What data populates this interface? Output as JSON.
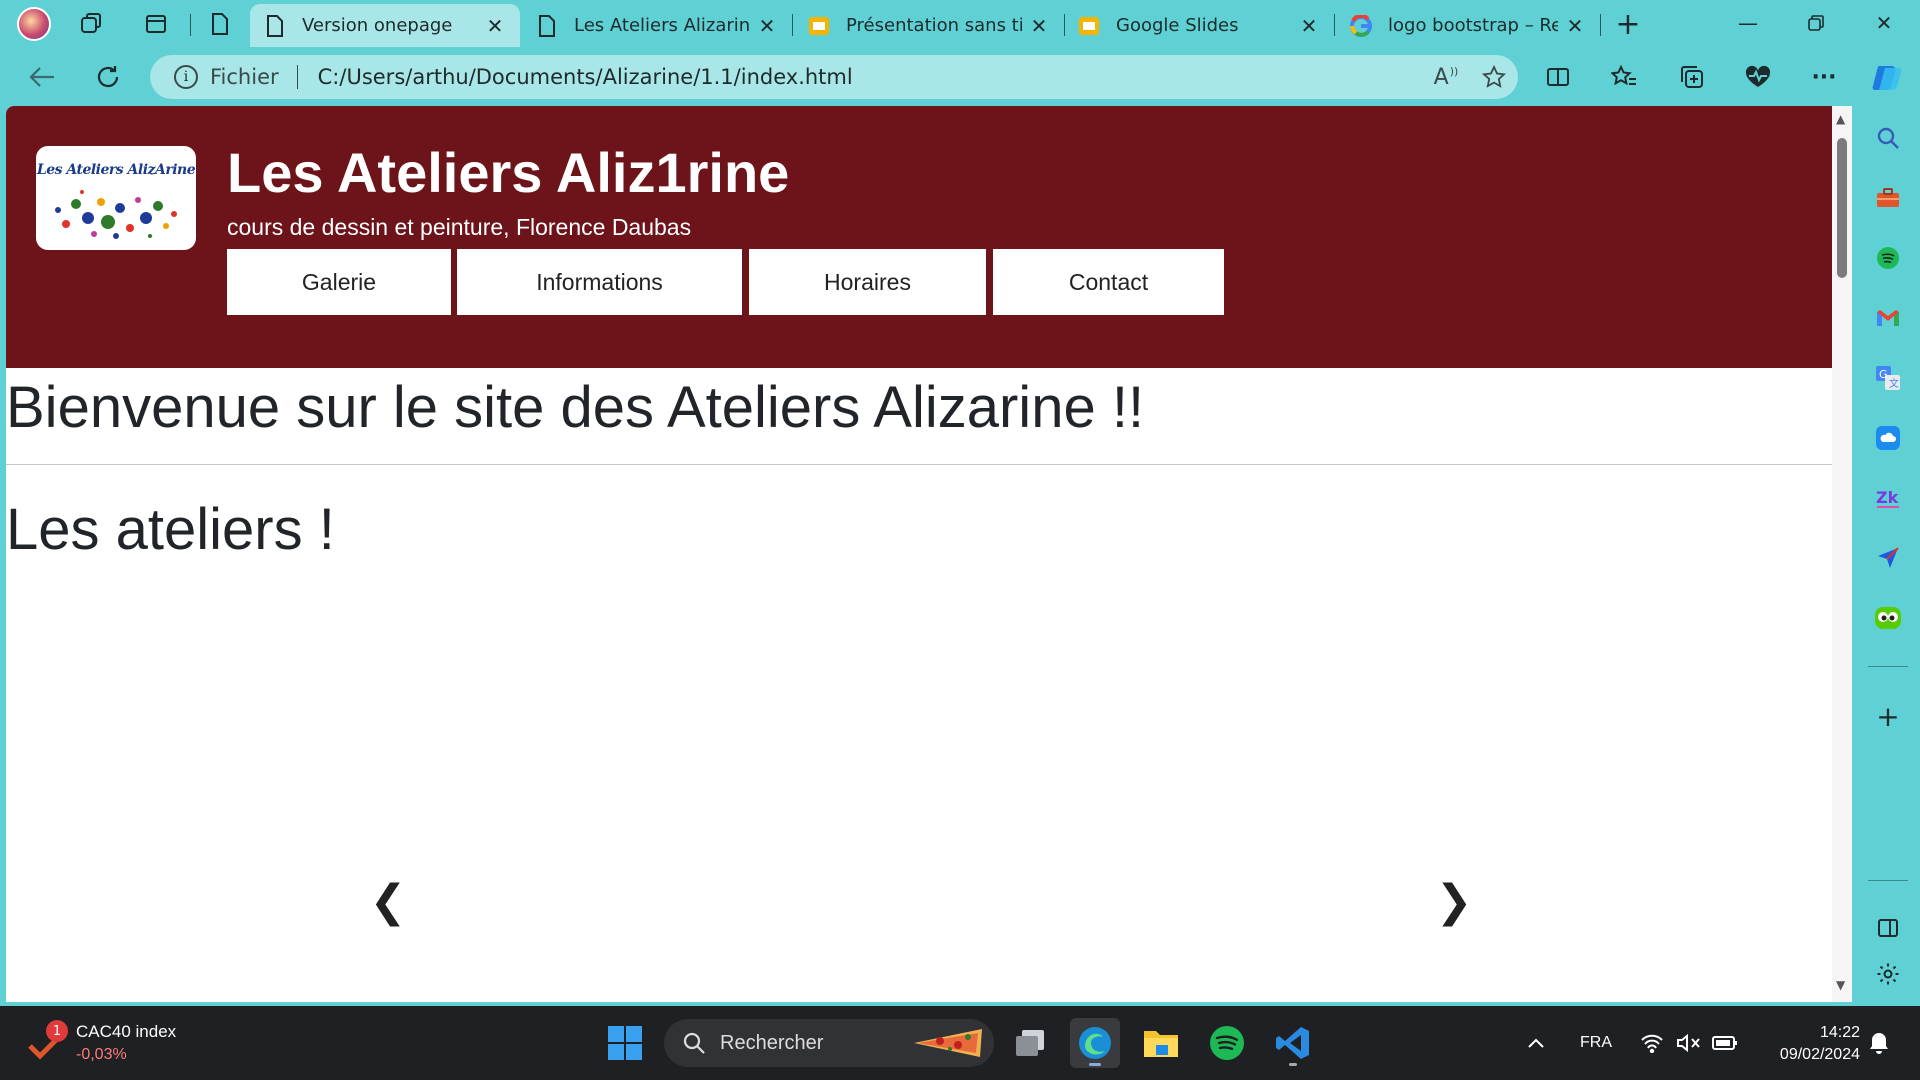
{
  "browser": {
    "tabs": [
      {
        "title": "Version onepage",
        "active": true
      },
      {
        "title": "Les Ateliers Alizarine",
        "active": false
      },
      {
        "title": "Présentation sans titre",
        "active": false
      },
      {
        "title": "Google Slides",
        "active": false
      },
      {
        "title": "logo bootstrap – Recherche",
        "active": false
      }
    ],
    "address": {
      "scheme_label": "Fichier",
      "url": "C:/Users/arthu/Documents/Alizarine/1.1/index.html"
    },
    "read_aloud_label": "A"
  },
  "page": {
    "logo_text": "Les Ateliers AlizArine",
    "site_title": "Les Ateliers Aliz1rine",
    "site_subtitle": "cours de dessin et peinture, Florence Daubas",
    "nav": [
      "Galerie",
      "Informations",
      "Horaires",
      "Contact"
    ],
    "heading": "Bienvenue sur le site des Ateliers Alizarine !!",
    "section_title": "Les ateliers !",
    "carousel": {
      "prev": "❮",
      "next": "❯"
    },
    "colors": {
      "header_bg": "#6d141b",
      "browser_frame": "#5fd0d3"
    }
  },
  "taskbar": {
    "widget": {
      "badge": "1",
      "name": "CAC40 index",
      "value": "-0,03%"
    },
    "search_placeholder": "Rechercher",
    "language": "FRA",
    "time": "14:22",
    "date": "09/02/2024"
  }
}
